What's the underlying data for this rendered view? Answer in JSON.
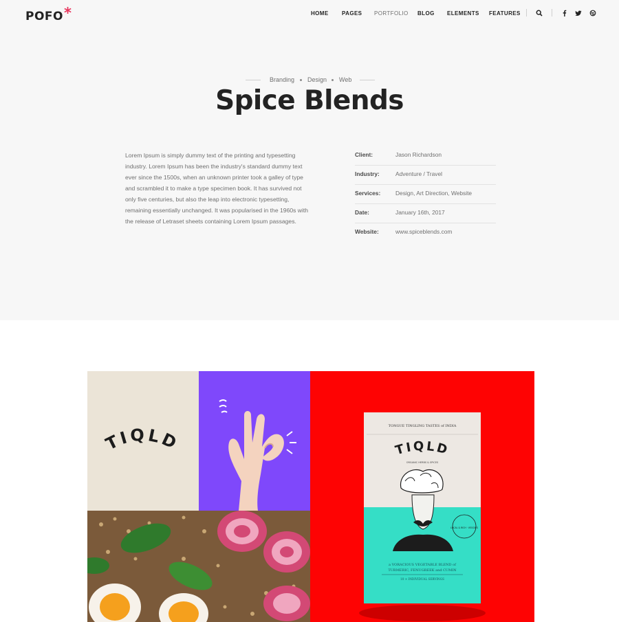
{
  "header": {
    "logo_text": "POFO",
    "logo_star": "*",
    "nav": [
      "HOME",
      "PAGES",
      "PORTFOLIO",
      "BLOG",
      "ELEMENTS",
      "FEATURES"
    ],
    "active_nav": "PORTFOLIO",
    "icons": [
      "search-icon",
      "facebook-icon",
      "twitter-icon",
      "dribbble-icon"
    ]
  },
  "project": {
    "categories": [
      "Branding",
      "Design",
      "Web"
    ],
    "title": "Spice Blends",
    "description": "Lorem Ipsum is simply dummy text of the printing and typesetting industry. Lorem Ipsum has been the industry's standard dummy text ever since the 1500s, when an unknown printer took a galley of type and scrambled it to make a type specimen book. It has survived not only five centuries, but also the leap into electronic typesetting, remaining essentially unchanged. It was popularised in the 1960s with the release of Letraset sheets containing Lorem Ipsum passages.",
    "meta": [
      {
        "label": "Client:",
        "value": "Jason Richardson"
      },
      {
        "label": "Industry:",
        "value": "Adventure / Travel"
      },
      {
        "label": "Services:",
        "value": "Design, Art Direction, Website"
      },
      {
        "label": "Date:",
        "value": "January 16th, 2017"
      },
      {
        "label": "Website:",
        "value": "www.spiceblends.com"
      }
    ]
  },
  "gallery": {
    "brand_logo": "TIQLD",
    "pouch": {
      "top_text": "TONGUE TINGLING TASTES of INDIA",
      "sub_text": "ORGANIC HERBS & SPICES",
      "stamp_text": "LOCAL & RICH · VEGGIES",
      "blend_text_1": "a VORACIOUS VEGETABLE BLEND of",
      "blend_text_2": "TURMERIC, FENUGREEK and CUMIN",
      "servings_text": "10 × INDIVIDUAL SERVINGS"
    },
    "colors": {
      "cream": "#ebe4d7",
      "purple": "#7f48fb",
      "red": "#fe0303",
      "teal": "#35dec6",
      "accent": "#e8375e"
    }
  }
}
